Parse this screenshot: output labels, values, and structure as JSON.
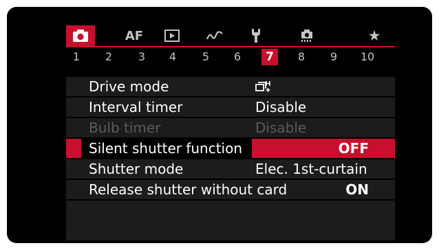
{
  "tabs": {
    "af_label": "AF",
    "selected": "camera"
  },
  "colors": {
    "accent": "#c8102e",
    "background": "#000000",
    "panel": "#1c1c1c",
    "text": "#ffffff",
    "disabled": "#5a5a5a"
  },
  "pages": [
    "1",
    "2",
    "3",
    "4",
    "5",
    "6",
    "7",
    "8",
    "9",
    "10"
  ],
  "active_page": "7",
  "menu": {
    "items": [
      {
        "label": "Drive mode",
        "value": "",
        "value_icon": "continuous-high-speed-icon",
        "state": "normal"
      },
      {
        "label": "Interval timer",
        "value": "Disable",
        "state": "normal"
      },
      {
        "label": "Bulb timer",
        "value": "Disable",
        "state": "disabled"
      },
      {
        "label": "Silent shutter function",
        "value": "OFF",
        "state": "selected"
      },
      {
        "label": "Shutter mode",
        "value": "Elec. 1st-curtain",
        "state": "normal"
      },
      {
        "label": "Release shutter without card",
        "value": "ON",
        "state": "normal"
      }
    ]
  }
}
